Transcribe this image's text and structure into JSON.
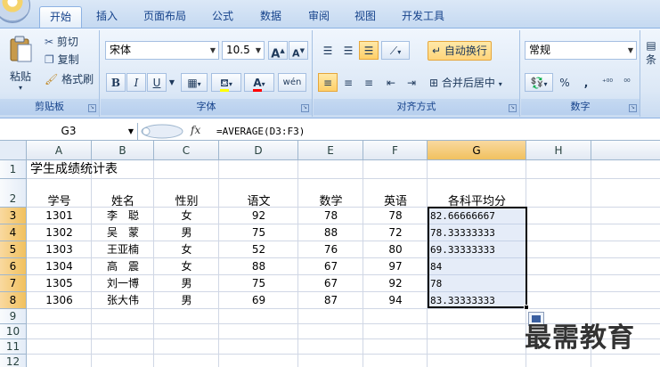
{
  "tabs": [
    "开始",
    "插入",
    "页面布局",
    "公式",
    "数据",
    "审阅",
    "视图",
    "开发工具"
  ],
  "active_tab": "开始",
  "ribbon": {
    "clipboard": {
      "label": "剪贴板",
      "paste": "粘贴",
      "cut": "剪切",
      "copy": "复制",
      "format_painter": "格式刷"
    },
    "font": {
      "label": "字体",
      "font_name": "宋体",
      "font_size": "10.5",
      "grow": "A",
      "shrink": "A",
      "bold": "B",
      "italic": "I",
      "underline": "U",
      "font_color": "A",
      "phonetic": "wén"
    },
    "alignment": {
      "label": "对齐方式",
      "wrap_text": "自动换行",
      "merge_center": "合并后居中"
    },
    "number": {
      "label": "数字",
      "format": "常规",
      "percent": "%",
      "comma": ","
    },
    "styles": {
      "partial": "条"
    }
  },
  "formula_bar": {
    "name_box": "G3",
    "fx": "fx",
    "formula": "=AVERAGE(D3:F3)"
  },
  "sheet": {
    "columns": [
      "A",
      "B",
      "C",
      "D",
      "E",
      "F",
      "G",
      "H"
    ],
    "selected_column": "G",
    "rows": [
      "1",
      "2",
      "3",
      "4",
      "5",
      "6",
      "7",
      "8",
      "9",
      "10",
      "11",
      "12"
    ],
    "title": "学生成绩统计表",
    "headers": [
      "学号",
      "姓名",
      "性别",
      "语文",
      "数学",
      "英语",
      "各科平均分"
    ],
    "data": [
      [
        "1301",
        "李　聪",
        "女",
        "92",
        "78",
        "78",
        "82.66666667"
      ],
      [
        "1302",
        "吴　蒙",
        "男",
        "75",
        "88",
        "72",
        "78.33333333"
      ],
      [
        "1303",
        "王亚楠",
        "女",
        "52",
        "76",
        "80",
        "69.33333333"
      ],
      [
        "1304",
        "高　震",
        "女",
        "88",
        "67",
        "97",
        "84"
      ],
      [
        "1305",
        "刘一博",
        "男",
        "75",
        "67",
        "92",
        "78"
      ],
      [
        "1306",
        "张大伟",
        "男",
        "69",
        "87",
        "94",
        "83.33333333"
      ]
    ]
  },
  "watermark": "最需教育"
}
